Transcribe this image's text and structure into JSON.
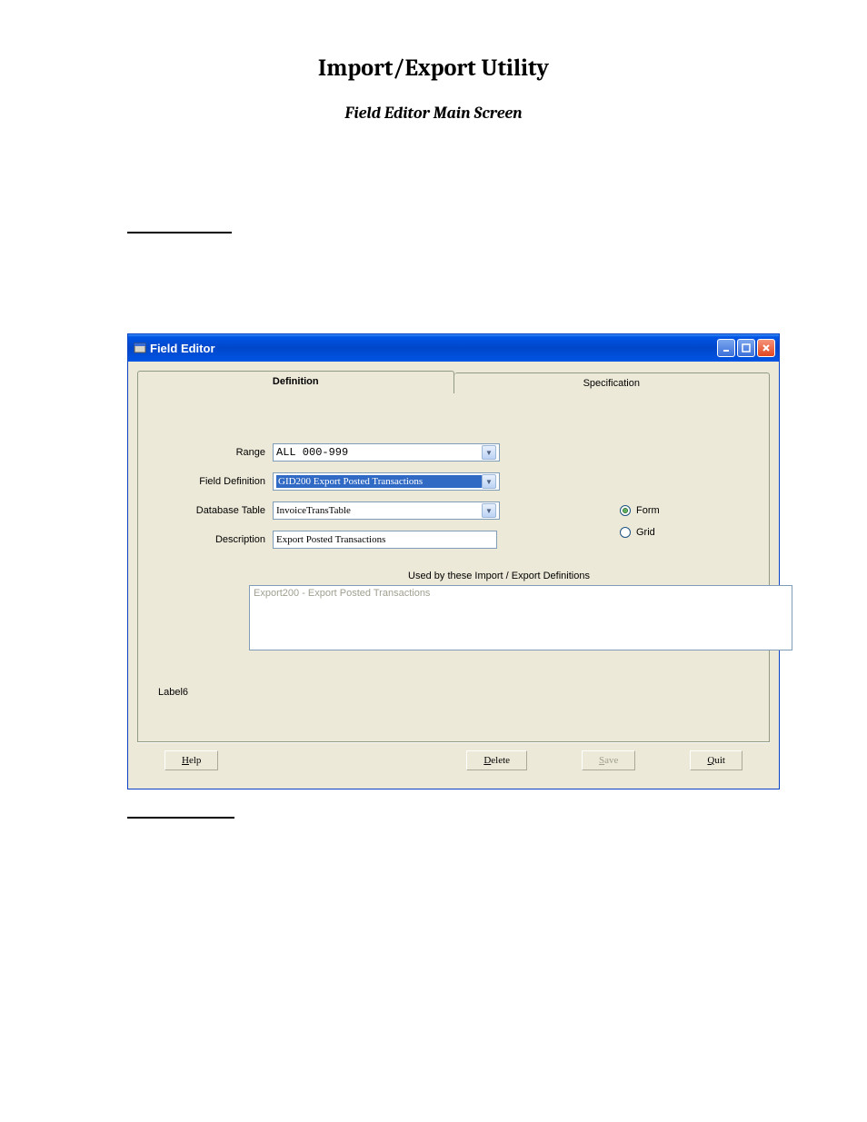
{
  "page": {
    "title": "Import/Export Utility",
    "subtitle": "Field Editor Main Screen"
  },
  "window": {
    "title": "Field Editor"
  },
  "tabs": {
    "definition": "Definition",
    "specification": "Specification"
  },
  "form": {
    "range_label": "Range",
    "range_value": "ALL       000-999",
    "field_definition_label": "Field Definition",
    "field_definition_value": "GID200   Export Posted Transactions",
    "database_table_label": "Database Table",
    "database_table_value": "InvoiceTransTable",
    "description_label": "Description",
    "description_value": "Export Posted Transactions"
  },
  "view_mode": {
    "form": "Form",
    "grid": "Grid",
    "selected": "Form"
  },
  "used_by": {
    "label": "Used by these Import / Export Definitions",
    "items": [
      "Export200 - Export Posted Transactions"
    ]
  },
  "misc": {
    "label6": "Label6"
  },
  "buttons": {
    "help_prefix": "H",
    "help_rest": "elp",
    "delete_prefix": "D",
    "delete_rest": "elete",
    "save_prefix": "S",
    "save_rest": "ave",
    "quit_prefix": "Q",
    "quit_rest": "uit"
  }
}
